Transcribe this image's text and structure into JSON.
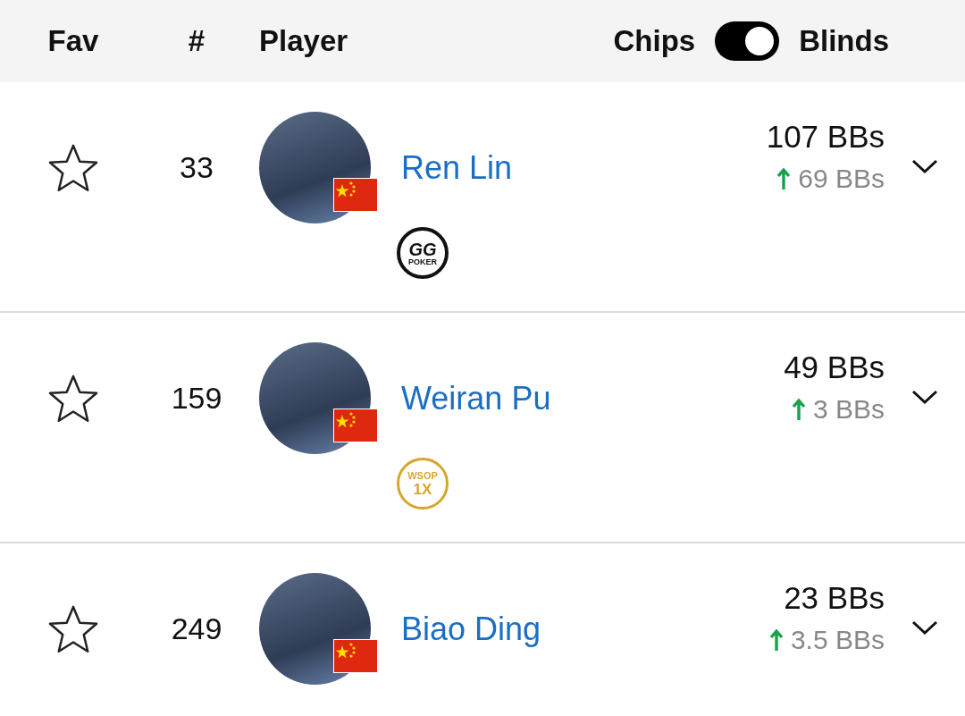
{
  "header": {
    "fav": "Fav",
    "rank": "#",
    "player": "Player",
    "toggle_left": "Chips",
    "toggle_right": "Blinds",
    "toggle_on": true
  },
  "players": [
    {
      "favorite": false,
      "rank": "33",
      "name": "Ren Lin",
      "stack": "107 BBs",
      "change": "69 BBs",
      "rising": true,
      "badge": {
        "kind": "gg",
        "text": "GG",
        "sub": "POKER"
      }
    },
    {
      "favorite": false,
      "rank": "159",
      "name": "Weiran Pu",
      "stack": "49 BBs",
      "change": "3 BBs",
      "rising": true,
      "badge": {
        "kind": "wsop",
        "text": "WSOP",
        "sub": "1X"
      }
    },
    {
      "favorite": false,
      "rank": "249",
      "name": "Biao Ding",
      "stack": "23 BBs",
      "change": "3.5 BBs",
      "rising": true
    }
  ]
}
